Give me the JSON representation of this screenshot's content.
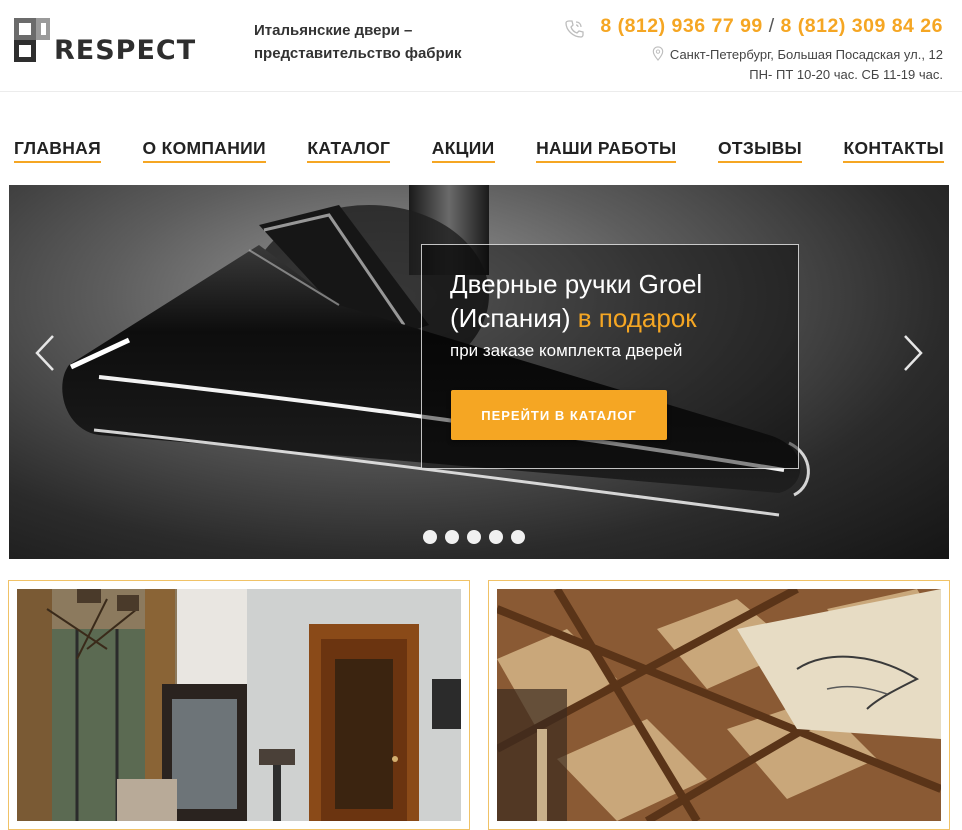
{
  "brand": {
    "logo_text": "RESPECT",
    "tagline": "Итальянские двери – представительство фабрик"
  },
  "contacts": {
    "phone_1": "8 (812) 936 77 99",
    "phone_separator": "/",
    "phone_2": "8 (812) 309 84 26",
    "address": "Санкт-Петербург, Большая Посадская ул., 12",
    "hours": "ПН- ПТ 10-20 час. СБ 11-19 час."
  },
  "nav": {
    "items": [
      {
        "label": "ГЛАВНАЯ"
      },
      {
        "label": "О КОМПАНИИ"
      },
      {
        "label": "КАТАЛОГ"
      },
      {
        "label": "АКЦИИ"
      },
      {
        "label": "НАШИ РАБОТЫ"
      },
      {
        "label": "ОТЗЫВЫ"
      },
      {
        "label": "КОНТАКТЫ"
      }
    ]
  },
  "hero": {
    "title_line1": "Дверные ручки Groel",
    "title_line2_plain": "(Испания) ",
    "title_line2_accent": "в подарок",
    "subtitle": "при заказе комплекта дверей",
    "cta_label": "ПЕРЕЙТИ В КАТАЛОГ",
    "slides_count": 5,
    "prev_icon": "chevron-left-icon",
    "next_icon": "chevron-right-icon"
  },
  "colors": {
    "accent": "#f5a623",
    "text": "#2b2b2b",
    "card_border": "#f0c267"
  }
}
